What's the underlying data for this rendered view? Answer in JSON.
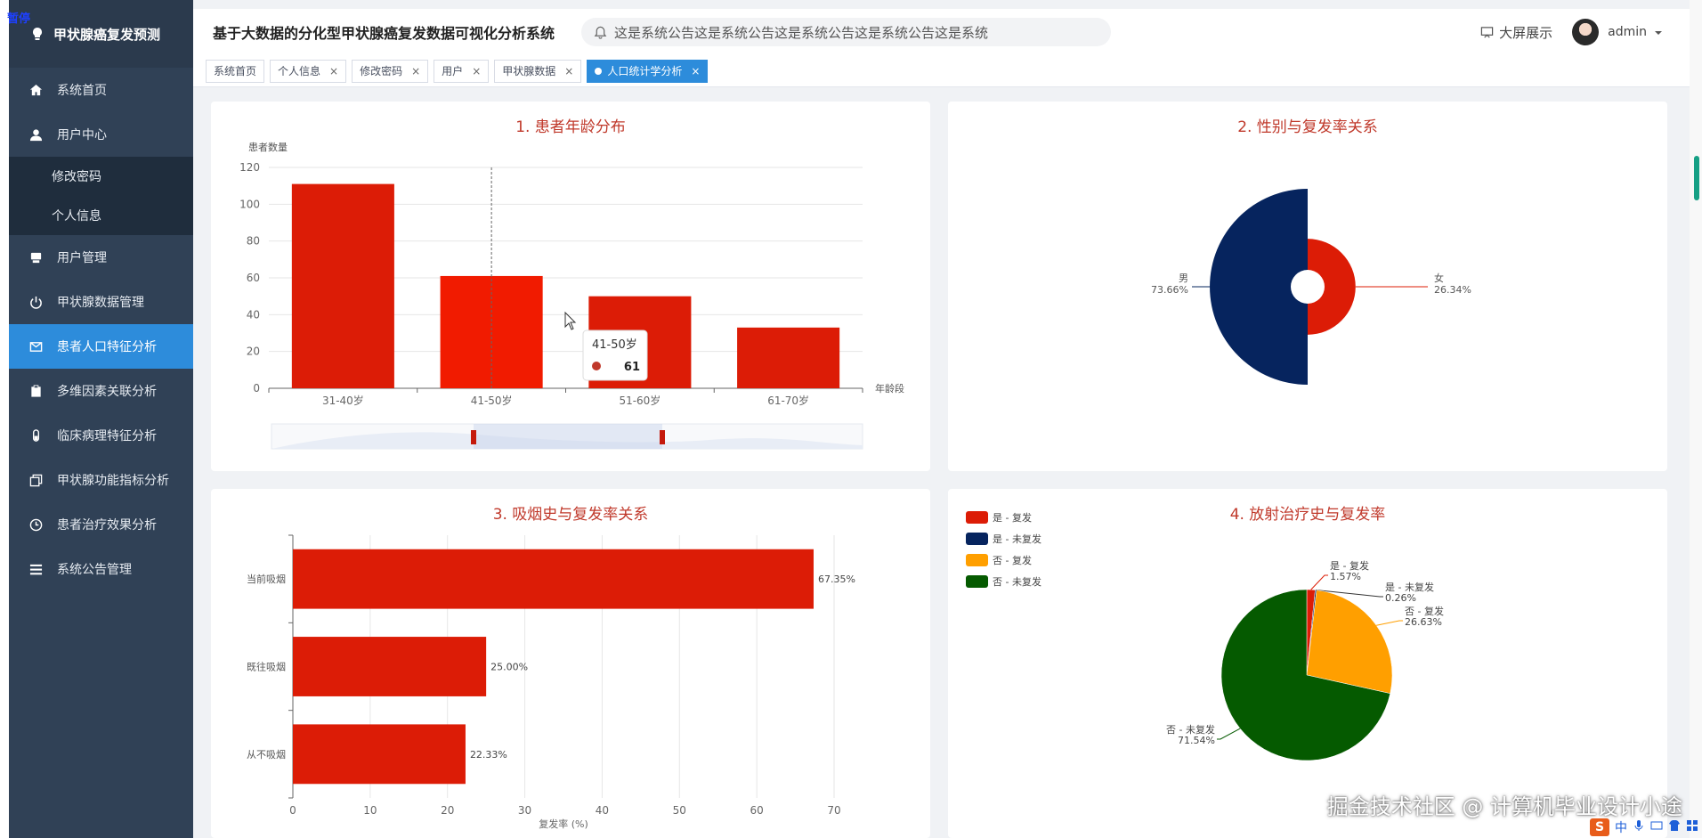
{
  "overlay": {
    "pause_label": "暂停"
  },
  "sidebar": {
    "brand": "甲状腺癌复发预测",
    "items": [
      {
        "label": "系统首页",
        "icon": "home-icon"
      },
      {
        "label": "用户中心",
        "icon": "user-icon"
      },
      {
        "label": "用户管理",
        "icon": "users-manage-icon"
      },
      {
        "label": "甲状腺数据管理",
        "icon": "power-icon"
      },
      {
        "label": "患者人口特征分析",
        "icon": "mail-icon",
        "active": true
      },
      {
        "label": "多维因素关联分析",
        "icon": "clipboard-icon"
      },
      {
        "label": "临床病理特征分析",
        "icon": "vial-icon"
      },
      {
        "label": "甲状腺功能指标分析",
        "icon": "copy-icon"
      },
      {
        "label": "患者治疗效果分析",
        "icon": "clock-icon"
      },
      {
        "label": "系统公告管理",
        "icon": "list-icon"
      }
    ],
    "subitems": [
      "修改密码",
      "个人信息"
    ]
  },
  "header": {
    "title": "基于大数据的分化型甲状腺癌复发数据可视化分析系统",
    "notice": "这是系统公告这是系统公告这是系统公告这是系统公告这是系统",
    "bigscreen": "大屏展示",
    "user": "admin"
  },
  "tags": [
    {
      "label": "系统首页",
      "closable": false
    },
    {
      "label": "个人信息",
      "closable": true
    },
    {
      "label": "修改密码",
      "closable": true
    },
    {
      "label": "用户",
      "closable": true
    },
    {
      "label": "甲状腺数据",
      "closable": true
    },
    {
      "label": "人口统计学分析",
      "closable": true,
      "active": true
    }
  ],
  "chart_data": [
    {
      "type": "bar",
      "title": "1. 患者年龄分布",
      "ylabel": "患者数量",
      "xlabel": "年龄段",
      "categories": [
        "31-40岁",
        "41-50岁",
        "51-60岁",
        "61-70岁"
      ],
      "values": [
        111,
        61,
        50,
        33
      ],
      "ylim": [
        0,
        120
      ],
      "yticks": [
        0,
        20,
        40,
        60,
        80,
        100,
        120
      ],
      "color": "#dc1c06",
      "highlight_color": "#f11b00",
      "tooltip": {
        "category": "41-50岁",
        "value": "61"
      }
    },
    {
      "type": "pie",
      "title": "2. 性别与复发率关系",
      "slices": [
        {
          "name": "男",
          "value": 73.66,
          "label": "73.66%",
          "color": "#06245e"
        },
        {
          "name": "女",
          "value": 26.34,
          "label": "26.34%",
          "color": "#dc1c06"
        }
      ]
    },
    {
      "type": "bar",
      "orientation": "horizontal",
      "title": "3. 吸烟史与复发率关系",
      "categories": [
        "当前吸烟",
        "既往吸烟",
        "从不吸烟"
      ],
      "values": [
        67.35,
        25.0,
        22.33
      ],
      "labels": [
        "67.35%",
        "25.00%",
        "22.33%"
      ],
      "xlim": [
        0,
        70
      ],
      "xticks": [
        0,
        10,
        20,
        30,
        40,
        50,
        60,
        70
      ],
      "xlabel": "复发率 (%)",
      "color": "#dc1c06"
    },
    {
      "type": "pie",
      "title": "4. 放射治疗史与复发率",
      "legend": "top-left",
      "slices": [
        {
          "name": "是 - 复发",
          "value": 1.57,
          "label": "1.57%",
          "color": "#dc1c06"
        },
        {
          "name": "是 - 未复发",
          "value": 0.26,
          "label": "0.26%",
          "color": "#06245e"
        },
        {
          "name": "否 - 复发",
          "value": 26.63,
          "label": "26.63%",
          "color": "#ff9f00"
        },
        {
          "name": "否 - 未复发",
          "value": 71.54,
          "label": "71.54%",
          "color": "#055a00"
        }
      ]
    }
  ],
  "watermark": "掘金技术社区 @ 计算机毕业设计小途",
  "ime": {
    "badge": "S",
    "lang": "中"
  }
}
